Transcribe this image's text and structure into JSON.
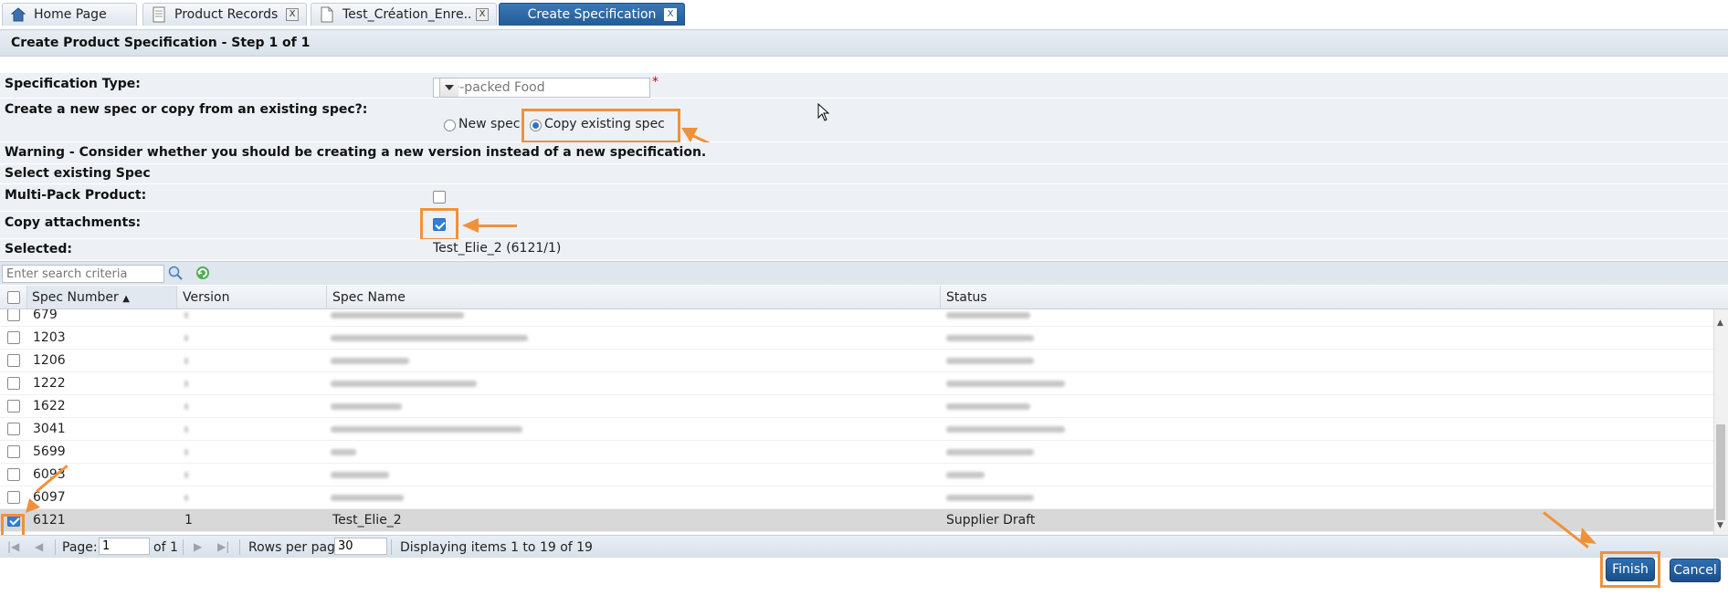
{
  "tabs": [
    {
      "label": "Home Page",
      "icon": "home-icon",
      "closable": false,
      "active": false
    },
    {
      "label": "Product Records",
      "icon": "records-icon",
      "closable": true,
      "active": false
    },
    {
      "label": "Test_Création_Enre..",
      "icon": "document-icon",
      "closable": true,
      "active": false
    },
    {
      "label": "Create Specification",
      "icon": "",
      "closable": true,
      "active": true
    }
  ],
  "close_glyph": "X",
  "page_title": "Create Product Specification - Step 1 of 1",
  "form": {
    "spec_type_label": "Specification Type:",
    "spec_type_value": "Pre-packed Food",
    "required_mark": "*",
    "create_mode_label": "Create a new spec or copy from an existing spec?:",
    "radio_new": "New spec",
    "radio_copy": "Copy existing spec",
    "selected_mode": "copy",
    "warning": "Warning - Consider whether you should be creating a new version instead of a new specification.",
    "select_existing_label": "Select existing Spec",
    "multipack_label": "Multi-Pack Product:",
    "multipack_checked": false,
    "copy_attachments_label": "Copy attachments:",
    "copy_attachments_checked": true,
    "selected_label": "Selected:",
    "selected_value": "Test_Elie_2 (6121/1)"
  },
  "search": {
    "placeholder": "Enter search criteria"
  },
  "grid": {
    "columns": [
      "Spec Number",
      "Version",
      "Spec Name",
      "Status"
    ],
    "sort_glyph": "▲",
    "rows": [
      {
        "num": "679",
        "version": "",
        "name": "",
        "status": "",
        "checked": false
      },
      {
        "num": "1203",
        "version": "",
        "name": "",
        "status": "",
        "checked": false
      },
      {
        "num": "1206",
        "version": "",
        "name": "",
        "status": "",
        "checked": false
      },
      {
        "num": "1222",
        "version": "",
        "name": "",
        "status": "",
        "checked": false
      },
      {
        "num": "1622",
        "version": "",
        "name": "",
        "status": "",
        "checked": false
      },
      {
        "num": "3041",
        "version": "",
        "name": "",
        "status": "",
        "checked": false
      },
      {
        "num": "5699",
        "version": "",
        "name": "",
        "status": "",
        "checked": false
      },
      {
        "num": "6093",
        "version": "",
        "name": "",
        "status": "",
        "checked": false
      },
      {
        "num": "6097",
        "version": "",
        "name": "",
        "status": "",
        "checked": false
      },
      {
        "num": "6121",
        "version": "1",
        "name": "Test_Elie_2",
        "status": "Supplier Draft",
        "checked": true
      }
    ]
  },
  "pager": {
    "page_label": "Page:",
    "page_value": "1",
    "of_label": "of 1",
    "rows_label": "Rows per page",
    "rows_value": "30",
    "display_text": "Displaying items 1 to 19 of 19"
  },
  "buttons": {
    "finish": "Finish",
    "cancel": "Cancel"
  },
  "colors": {
    "accent": "#235c97",
    "highlight": "#f0913a",
    "required": "#d40000"
  }
}
